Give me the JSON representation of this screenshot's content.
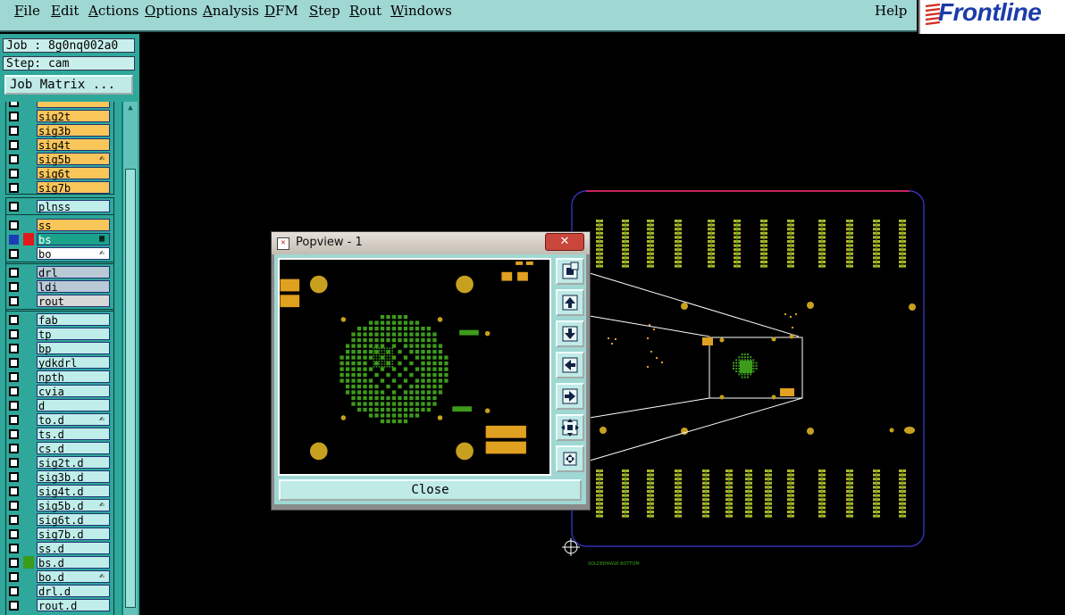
{
  "menu": {
    "items": [
      "File",
      "Edit",
      "Actions",
      "Options",
      "Analysis",
      "DFM",
      "Step",
      "Rout",
      "Windows"
    ],
    "help": "Help"
  },
  "logo": {
    "text": "Frontline"
  },
  "job": {
    "label": "Job : 8g0nq002a0",
    "step": "Step: cam"
  },
  "job_matrix_button": "Job Matrix ...",
  "layers": [
    {
      "name": "sig2t",
      "color": "#f9c65a",
      "flag": ""
    },
    {
      "name": "sig3b",
      "color": "#f9c65a",
      "flag": ""
    },
    {
      "name": "sig4t",
      "color": "#f9c65a",
      "flag": ""
    },
    {
      "name": "sig5b",
      "color": "#f9c65a",
      "flag": "hand"
    },
    {
      "name": "sig6t",
      "color": "#f9c65a",
      "flag": ""
    },
    {
      "name": "sig7b",
      "color": "#f9c65a",
      "flag": ""
    },
    {
      "name": "plnss",
      "color": "#bfeeea",
      "flag": ""
    },
    {
      "name": "ss",
      "color": "#f9c65a",
      "flag": ""
    },
    {
      "name": "bs",
      "color": "#1aa38a",
      "flag": "grid",
      "selected": true
    },
    {
      "name": "bo",
      "color": "#ffffff",
      "flag": "hand"
    },
    {
      "name": "drl",
      "color": "#b9c9d6",
      "flag": ""
    },
    {
      "name": "ldi",
      "color": "#b9c9d6",
      "flag": ""
    },
    {
      "name": "rout",
      "color": "#d8d8d8",
      "flag": ""
    },
    {
      "name": "fab",
      "color": "#bfeeea",
      "flag": ""
    },
    {
      "name": "tp",
      "color": "#bfeeea",
      "flag": ""
    },
    {
      "name": "bp",
      "color": "#bfeeea",
      "flag": ""
    },
    {
      "name": "ydkdrl",
      "color": "#bfeeea",
      "flag": ""
    },
    {
      "name": "npth",
      "color": "#bfeeea",
      "flag": ""
    },
    {
      "name": "cvia",
      "color": "#bfeeea",
      "flag": ""
    },
    {
      "name": "d",
      "color": "#bfeeea",
      "flag": ""
    },
    {
      "name": "to.d",
      "color": "#bfeeea",
      "flag": "hand"
    },
    {
      "name": "ts.d",
      "color": "#bfeeea",
      "flag": ""
    },
    {
      "name": "cs.d",
      "color": "#bfeeea",
      "flag": ""
    },
    {
      "name": "sig2t.d",
      "color": "#bfeeea",
      "flag": ""
    },
    {
      "name": "sig3b.d",
      "color": "#bfeeea",
      "flag": ""
    },
    {
      "name": "sig4t.d",
      "color": "#bfeeea",
      "flag": ""
    },
    {
      "name": "sig5b.d",
      "color": "#bfeeea",
      "flag": "hand"
    },
    {
      "name": "sig6t.d",
      "color": "#bfeeea",
      "flag": ""
    },
    {
      "name": "sig7b.d",
      "color": "#bfeeea",
      "flag": ""
    },
    {
      "name": "ss.d",
      "color": "#bfeeea",
      "flag": ""
    },
    {
      "name": "bs.d",
      "color": "#bfeeea",
      "flag": "",
      "swatch": "#3a9a1a"
    },
    {
      "name": "bo.d",
      "color": "#bfeeea",
      "flag": "hand"
    },
    {
      "name": "drl.d",
      "color": "#bfeeea",
      "flag": ""
    },
    {
      "name": "rout.d",
      "color": "#bfeeea",
      "flag": ""
    }
  ],
  "canvas": {
    "layer_label": "SOLDERMASK BOTTOM",
    "colors": {
      "board_outline": "#3b3bd6",
      "board_top_edge": "#ff2a6a",
      "pad_green": "#3d9b1c",
      "pad_olive": "#b5b52a",
      "pad_gold": "#c8a020",
      "pad_orange": "#e0a020"
    }
  },
  "popview": {
    "title": "Popview - 1",
    "close_x": "✕",
    "close_button": "Close",
    "tools": [
      "zoom-home-icon",
      "pan-up-icon",
      "pan-down-icon",
      "pan-left-icon",
      "pan-right-icon",
      "zoom-out-icon",
      "fit-icon"
    ]
  }
}
